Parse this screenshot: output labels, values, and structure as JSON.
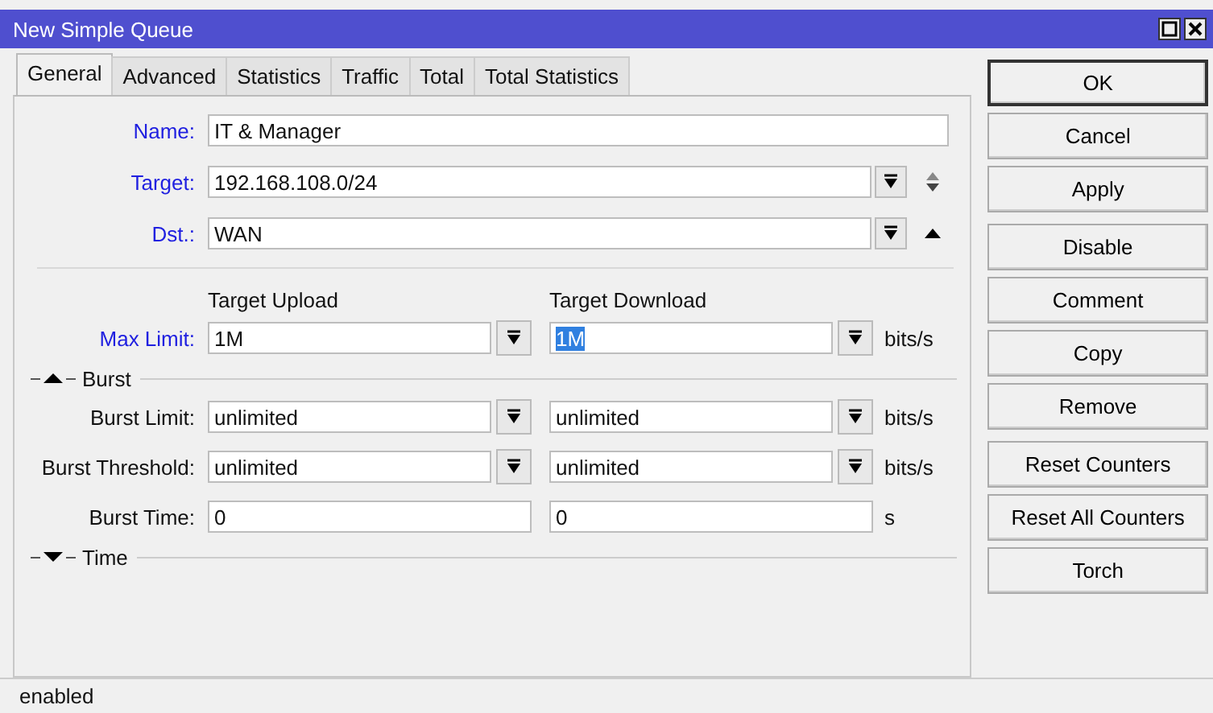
{
  "window": {
    "title": "New Simple Queue"
  },
  "tabs": [
    {
      "label": "General",
      "selected": true
    },
    {
      "label": "Advanced",
      "selected": false
    },
    {
      "label": "Statistics",
      "selected": false
    },
    {
      "label": "Traffic",
      "selected": false
    },
    {
      "label": "Total",
      "selected": false
    },
    {
      "label": "Total Statistics",
      "selected": false
    }
  ],
  "fields": [
    {
      "label": "Name:",
      "required": true,
      "value": "IT & Manager",
      "kind": "text"
    },
    {
      "label": "Target:",
      "required": true,
      "value": "192.168.108.0/24",
      "kind": "multi"
    },
    {
      "label": "Dst.:",
      "required": true,
      "value": "WAN",
      "kind": "single"
    }
  ],
  "columns": [
    "Target Upload",
    "Target Download"
  ],
  "rows": [
    {
      "kind": "dropdown",
      "label": "Max Limit:",
      "required": true,
      "upload": {
        "value": "1M",
        "highlighted": false
      },
      "download": {
        "value": "1M",
        "highlighted": true
      },
      "unit": "bits/s"
    },
    {
      "kind": "section",
      "title": "Burst",
      "expanded": true
    },
    {
      "kind": "dropdown",
      "label": "Burst Limit:",
      "required": false,
      "upload": {
        "value": "unlimited",
        "highlighted": false
      },
      "download": {
        "value": "unlimited",
        "highlighted": false
      },
      "unit": "bits/s"
    },
    {
      "kind": "dropdown",
      "label": "Burst Threshold:",
      "required": false,
      "upload": {
        "value": "unlimited",
        "highlighted": false
      },
      "download": {
        "value": "unlimited",
        "highlighted": false
      },
      "unit": "bits/s"
    },
    {
      "kind": "plain",
      "label": "Burst Time:",
      "required": false,
      "upload": {
        "value": "0",
        "highlighted": false
      },
      "download": {
        "value": "0",
        "highlighted": false
      },
      "unit": "s"
    },
    {
      "kind": "section",
      "title": "Time",
      "expanded": false
    }
  ],
  "button_groups": [
    [
      {
        "label": "OK",
        "default": true
      },
      {
        "label": "Cancel",
        "default": false
      },
      {
        "label": "Apply",
        "default": false
      }
    ],
    [
      {
        "label": "Disable",
        "default": false
      },
      {
        "label": "Comment",
        "default": false
      },
      {
        "label": "Copy",
        "default": false
      },
      {
        "label": "Remove",
        "default": false
      }
    ],
    [
      {
        "label": "Reset Counters",
        "default": false
      },
      {
        "label": "Reset All Counters",
        "default": false
      },
      {
        "label": "Torch",
        "default": false
      }
    ]
  ],
  "status_bar": {
    "text": "enabled"
  }
}
